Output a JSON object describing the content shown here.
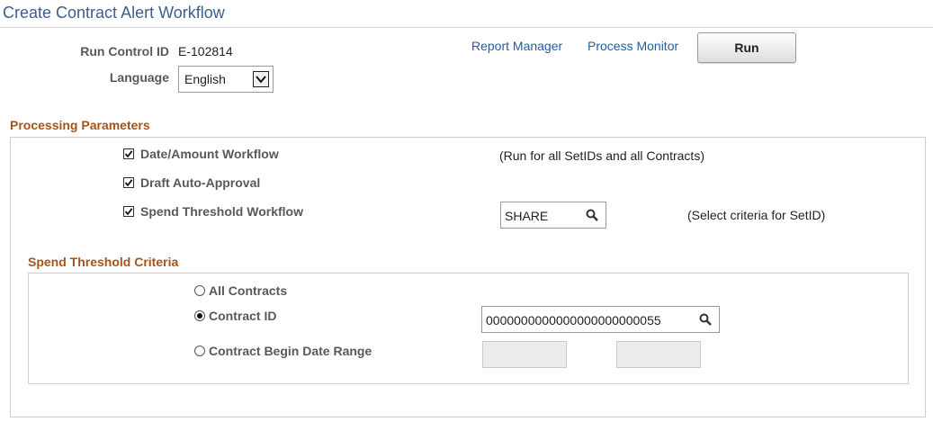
{
  "page": {
    "title": "Create Contract Alert Workflow"
  },
  "header": {
    "run_control_label": "Run Control ID",
    "run_control_value": "E-102814",
    "language_label": "Language",
    "language_value": "English",
    "links": {
      "report_manager": "Report Manager",
      "process_monitor": "Process Monitor"
    },
    "run_label": "Run"
  },
  "processing": {
    "title": "Processing Parameters",
    "date_amount": {
      "label": "Date/Amount Workflow",
      "checked": true,
      "note": "(Run for all SetIDs and all Contracts)"
    },
    "draft_approval": {
      "label": "Draft Auto-Approval",
      "checked": true
    },
    "spend_threshold": {
      "label": "Spend Threshold Workflow",
      "checked": true,
      "setid_value": "SHARE",
      "note": "(Select criteria for SetID)"
    }
  },
  "criteria": {
    "title": "Spend Threshold Criteria",
    "all_contracts": {
      "label": "All Contracts",
      "selected": false
    },
    "contract_id": {
      "label": "Contract ID",
      "selected": true,
      "value": "0000000000000000000000055"
    },
    "date_range": {
      "label": "Contract Begin Date Range",
      "selected": false,
      "from": "",
      "to": ""
    }
  },
  "icons": {
    "search": "search-icon",
    "dropdown": "chevron-down-icon",
    "check": "check-icon"
  }
}
